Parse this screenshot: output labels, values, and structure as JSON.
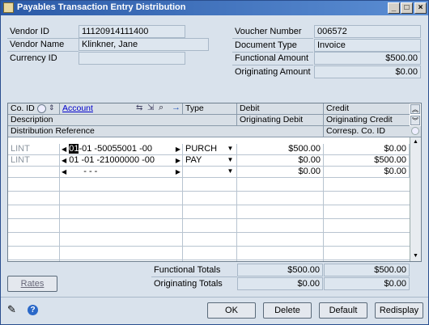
{
  "window": {
    "title": "Payables Transaction Entry Distribution"
  },
  "header_left": {
    "vendor_id_label": "Vendor ID",
    "vendor_id": "11120914111400",
    "vendor_name_label": "Vendor Name",
    "vendor_name": "Klinkner, Jane",
    "currency_id_label": "Currency ID",
    "currency_id": ""
  },
  "header_right": {
    "voucher_number_label": "Voucher Number",
    "voucher_number": "006572",
    "document_type_label": "Document Type",
    "document_type": "Invoice",
    "functional_amount_label": "Functional Amount",
    "functional_amount": "$500.00",
    "originating_amount_label": "Originating Amount",
    "originating_amount": "$0.00"
  },
  "grid": {
    "headers": {
      "co_id": "Co. ID",
      "account": "Account",
      "type": "Type",
      "debit": "Debit",
      "credit": "Credit",
      "description": "Description",
      "originating_debit": "Originating Debit",
      "originating_credit": "Originating Credit",
      "distribution_reference": "Distribution Reference",
      "corresp_co_id": "Corresp. Co. ID"
    },
    "rows": [
      {
        "co_id": "LINT",
        "account_highlight": "01",
        "account_rest": "-01 -50055001 -00",
        "type": "PURCH",
        "debit": "$500.00",
        "credit": "$0.00"
      },
      {
        "co_id": "LINT",
        "account_highlight": "",
        "account_rest": "01 -01 -21000000 -00",
        "type": "PAY",
        "debit": "$0.00",
        "credit": "$500.00"
      },
      {
        "co_id": "",
        "account_highlight": "",
        "account_rest": "-   -           -",
        "type": "",
        "debit": "$0.00",
        "credit": "$0.00"
      }
    ]
  },
  "totals": {
    "functional_label": "Functional Totals",
    "functional_debit": "$500.00",
    "functional_credit": "$500.00",
    "originating_label": "Originating Totals",
    "originating_debit": "$0.00",
    "originating_credit": "$0.00"
  },
  "buttons": {
    "rates": "Rates",
    "ok": "OK",
    "delete": "Delete",
    "default": "Default",
    "redisplay": "Redisplay"
  },
  "colors": {
    "titlebar": "#2b5aa7",
    "window_bg": "#d9e2ec",
    "link": "#0000cc"
  }
}
